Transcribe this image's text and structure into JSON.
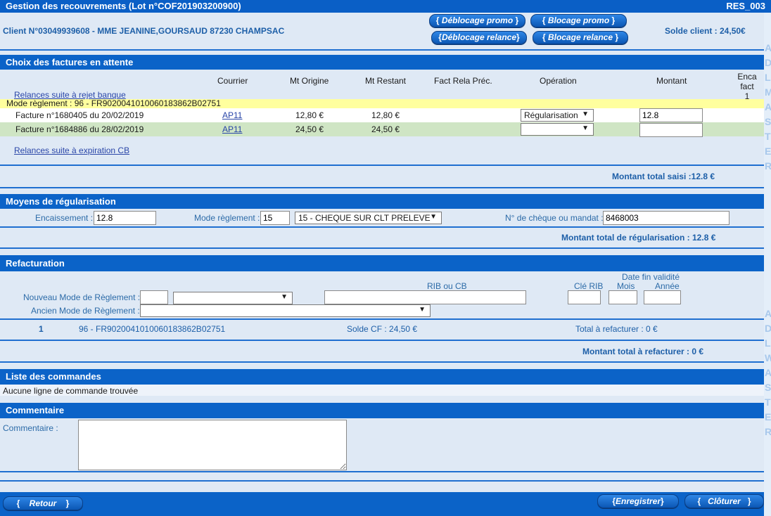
{
  "header": {
    "title": "Gestion des recouvrements (Lot n°COF201903200900)",
    "code": "RES_003",
    "client": "Client N°03049939608 - MME JEANINE,GOURSAUD 87230 CHAMPSAC",
    "solde": "Solde client : 24,50€",
    "buttons": {
      "deblocage_promo": "Déblocage promo",
      "blocage_promo": "Blocage promo",
      "deblocage_relance": "Déblocage relance",
      "blocage_relance": "Blocage relance"
    }
  },
  "factures": {
    "title": "Choix des factures en attente",
    "columns": {
      "courrier": "Courrier",
      "mt_origine": "Mt Origine",
      "mt_restant": "Mt Restant",
      "fact_rela": "Fact Rela Préc.",
      "operation": "Opération",
      "montant": "Montant",
      "enca_fact": "Enca fact",
      "enca_num": "1"
    },
    "relances_rejet": "Relances suite à rejet banque",
    "mode_reglement": "Mode règlement : 96 - FR9020041010060183862B02751",
    "rows": [
      {
        "label": "Facture n°1680405 du 20/02/2019",
        "courrier": "AP11",
        "origine": "12,80 €",
        "restant": "12,80 €",
        "operation": "Régularisation",
        "montant": "12.8"
      },
      {
        "label": "Facture n°1684886 du 28/02/2019",
        "courrier": "AP11",
        "origine": "24,50 €",
        "restant": "24,50 €",
        "operation": "",
        "montant": ""
      }
    ],
    "relances_cb": "Relances suite à expiration CB",
    "total": "Montant total saisi :12.8 €"
  },
  "moyens": {
    "title": "Moyens de régularisation",
    "encaissement_label": "Encaissement :",
    "encaissement_value": "12.8",
    "mode_label": "Mode règlement :",
    "mode_code": "15",
    "mode_select": "15 - CHEQUE SUR CLT PRELEVE",
    "cheque_label": "N° de chèque ou mandat :",
    "cheque_value": "8468003",
    "total": "Montant total de régularisation : 12.8 €"
  },
  "refacturation": {
    "title": "Refacturation",
    "rib_label": "RIB ou CB",
    "cle_rib": "Clé RIB",
    "date_fin": "Date fin validité",
    "mois": "Mois",
    "annee": "Année",
    "nouveau_label": "Nouveau Mode de Règlement :",
    "ancien_label": "Ancien Mode de Règlement :",
    "line": {
      "num": "1",
      "mode": "96 - FR9020041010060183862B02751",
      "solde": "Solde CF : 24,50 €",
      "total": "Total à refacturer : 0 €"
    },
    "total": "Montant total à refacturer : 0 €"
  },
  "commandes": {
    "title": "Liste des commandes",
    "empty": "Aucune ligne de commande trouvée"
  },
  "commentaire": {
    "title": "Commentaire",
    "label": "Commentaire :"
  },
  "footer": {
    "retour": "Retour",
    "enregistrer": "Enregistrer",
    "cloturer": "Clôturer"
  },
  "side_letters_top": [
    "A",
    "D",
    "L",
    "M",
    "A",
    "S",
    "T",
    "E",
    "R"
  ],
  "side_letters_bottom": [
    "A",
    "D",
    "L",
    "W",
    "A",
    "S",
    "T",
    "E",
    "R"
  ]
}
